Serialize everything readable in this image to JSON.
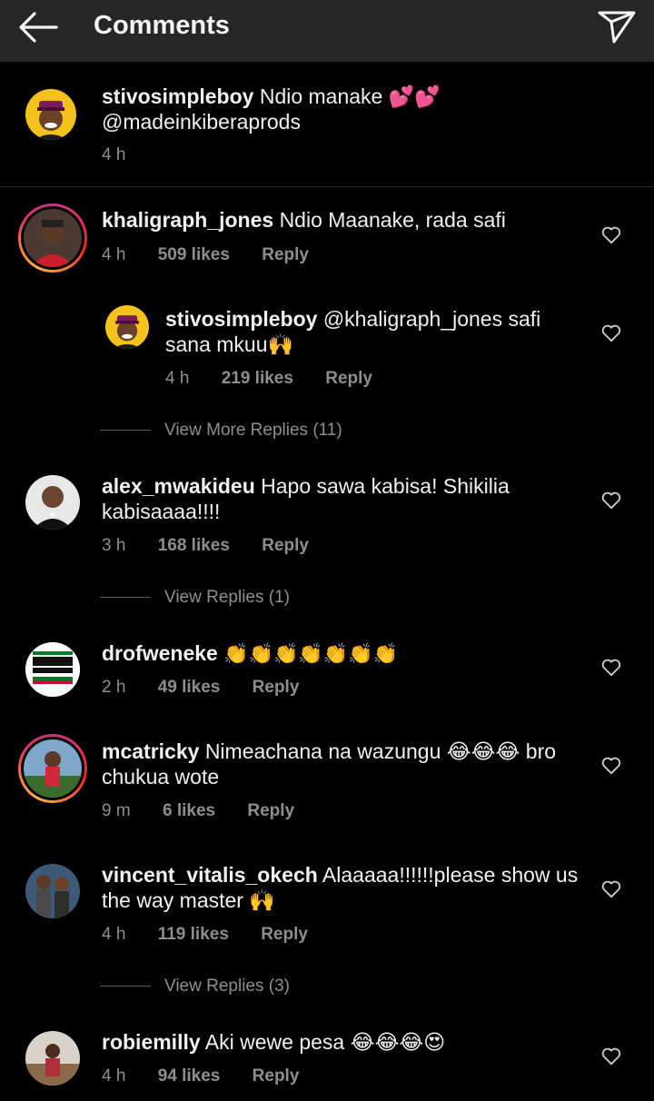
{
  "header": {
    "title": "Comments",
    "back_icon": "back-arrow-icon",
    "send_icon": "direct-send-icon"
  },
  "caption": {
    "username": "stivosimpleboy",
    "text": "Ndio manake 💕💕",
    "mention": "@madeinkiberaprods",
    "time": "4 h"
  },
  "comments": [
    {
      "username": "khaligraph_jones",
      "text": "Ndio Maanake, rada safi",
      "time": "4 h",
      "likes": "509 likes",
      "reply": "Reply"
    },
    {
      "username": "stivosimpleboy",
      "text": "@khaligraph_jones safi",
      "text2": "sana mkuu🙌",
      "time": "4 h",
      "likes": "219 likes",
      "reply": "Reply"
    },
    {
      "username": "alex_mwakideu",
      "text": "Hapo sawa kabisa! Shikilia",
      "text2": "kabisaaaa!!!!",
      "time": "3 h",
      "likes": "168 likes",
      "reply": "Reply"
    },
    {
      "username": "drofweneke",
      "text": "👏👏👏👏👏👏👏",
      "time": "2 h",
      "likes": "49 likes",
      "reply": "Reply"
    },
    {
      "username": "mcatricky",
      "text": "Nimeachana na wazungu 😂😂😂 bro",
      "text2": "chukua wote",
      "time": "9 m",
      "likes": "6 likes",
      "reply": "Reply"
    },
    {
      "username": "vincent_vitalis_okech",
      "text": "Alaaaaa!!!!!!please show us",
      "text2": "the way master 🙌",
      "time": "4 h",
      "likes": "119 likes",
      "reply": "Reply"
    },
    {
      "username": "robiemilly",
      "text": "Aki wewe pesa 😂😂😂😍",
      "time": "4 h",
      "likes": "94 likes",
      "reply": "Reply"
    }
  ],
  "view_replies": [
    "View More Replies (11)",
    "View Replies (1)",
    "View Replies (3)"
  ],
  "colors": {
    "background": "#000000",
    "header": "#262626",
    "meta_gray": "#8e8e8e",
    "story_ring": "#e1306c"
  }
}
